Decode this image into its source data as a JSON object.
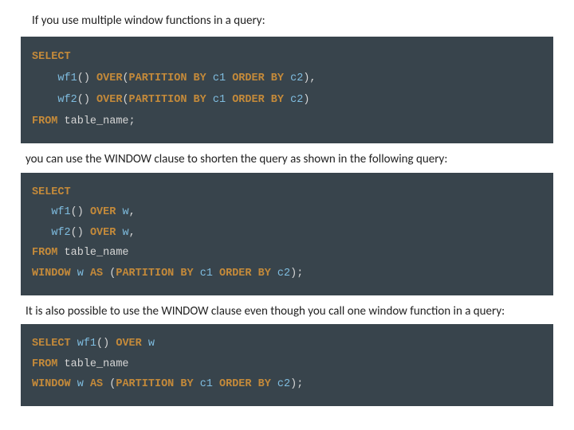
{
  "para1": "If you use multiple window functions in a query:",
  "para2": "you can use the WINDOW clause to shorten the query as shown in the following query:",
  "para3": "It is also possible to use the WINDOW clause even though you call one window function in a query:",
  "code1": {
    "l1": "SELECT",
    "l2_func": "wf1",
    "l2_over": "OVER",
    "l2_part": "PARTITION BY",
    "l2_c1": "c1",
    "l2_ord": "ORDER BY",
    "l2_c2": "c2",
    "l3_func": "wf2",
    "l4_from": "FROM",
    "l4_table": "table_name"
  },
  "code2": {
    "l1": "SELECT",
    "l2_func": "wf1",
    "l2_over": "OVER",
    "l2_w": "w",
    "l3_func": "wf2",
    "l4_from": "FROM",
    "l4_table": "table_name",
    "l5_window": "WINDOW",
    "l5_w": "w",
    "l5_as": "AS",
    "l5_part": "PARTITION BY",
    "l5_c1": "c1",
    "l5_ord": "ORDER BY",
    "l5_c2": "c2"
  },
  "code3": {
    "l1_select": "SELECT",
    "l1_func": "wf1",
    "l1_over": "OVER",
    "l1_w": "w",
    "l2_from": "FROM",
    "l2_table": "table_name",
    "l3_window": "WINDOW",
    "l3_w": "w",
    "l3_as": "AS",
    "l3_part": "PARTITION BY",
    "l3_c1": "c1",
    "l3_ord": "ORDER BY",
    "l3_c2": "c2"
  }
}
